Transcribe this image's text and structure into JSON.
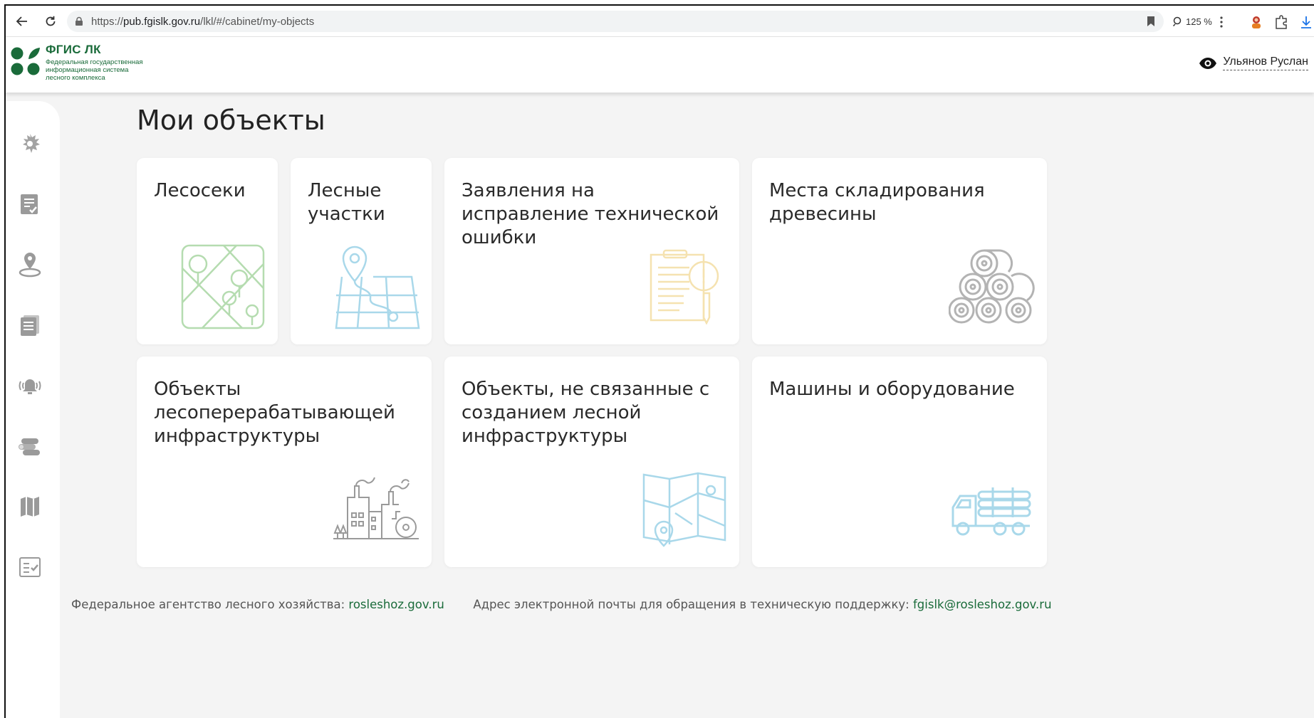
{
  "browser": {
    "url_prefix": "https://",
    "url_host": "pub.fgislk.gov.ru",
    "url_path": "/lkl/#/cabinet/my-objects",
    "zoom": "125 %"
  },
  "header": {
    "brand_title": "ФГИС ЛК",
    "brand_subtitle": "Федеральная государственная информационная система лесного комплекса",
    "user_name": "Ульянов Руслан"
  },
  "main": {
    "title": "Мои объекты",
    "cards": [
      {
        "title": "Лесосеки",
        "icon": "forest-plot-icon"
      },
      {
        "title": "Лесные участки",
        "icon": "map-pin-map-icon"
      },
      {
        "title": "Заявления на исправление технической ошибки",
        "icon": "document-error-icon"
      },
      {
        "title": "Места складирования древесины",
        "icon": "log-pile-icon"
      },
      {
        "title": "Объекты лесоперерабатывающей инфраструктуры",
        "icon": "sawmill-factory-icon"
      },
      {
        "title": "Объекты, не связанные с созданием лесной инфраструктуры",
        "icon": "folded-map-icon"
      },
      {
        "title": "Машины и оборудование",
        "icon": "timber-truck-icon"
      }
    ]
  },
  "sidebar": {
    "items": [
      "emblem-icon",
      "checklist-icon",
      "location-pin-icon",
      "documents-icon",
      "alarm-icon",
      "logs-icon",
      "map-icon",
      "tasks-icon"
    ]
  },
  "footer": {
    "agency_label": "Федеральное агентство лесного хозяйства:",
    "agency_link": "rosleshoz.gov.ru",
    "support_label": "Адрес электронной почты для обращения в техническую поддержку:",
    "support_link": "fgislk@rosleshoz.gov.ru"
  },
  "colors": {
    "brand_green": "#1a6b3a",
    "icon_green": "#b5dcb0",
    "icon_blue": "#a9d8ea",
    "icon_yellow": "#f5e2b0",
    "icon_gray": "#b3b3b3",
    "sidebar_icon": "#9a9a9a"
  }
}
